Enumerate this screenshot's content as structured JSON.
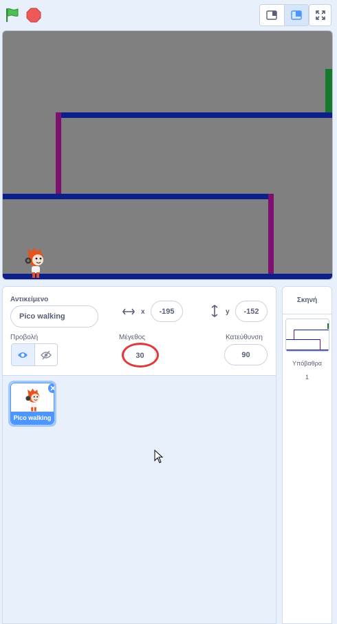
{
  "toolbar": {
    "green_flag_icon": "green-flag-icon",
    "stop_icon": "stop-sign-icon",
    "small_stage_icon": "small-stage-icon",
    "normal_stage_icon": "normal-stage-icon",
    "fullscreen_icon": "fullscreen-icon"
  },
  "stage": {
    "background_color": "#808080",
    "platform_blue": "#0c1f8a",
    "wall_purple": "#7d0f6e",
    "goal_green": "#157a2c",
    "sprite_color": "#e8521c"
  },
  "sprite_info": {
    "sprite_label": "Αντικείμενο",
    "sprite_name": "Pico walking",
    "x_label": "x",
    "x_value": "-195",
    "y_label": "y",
    "y_value": "-152",
    "show_label": "Προβολή",
    "size_label": "Μέγεθος",
    "size_value": "30",
    "direction_label": "Κατεύθυνση",
    "direction_value": "90"
  },
  "sprite_list": {
    "items": [
      {
        "name": "Pico walking",
        "selected": true
      }
    ]
  },
  "stage_panel": {
    "title": "Σκηνή",
    "backdrops_label": "Υπόβαθρα",
    "backdrops_count": "1"
  },
  "colors": {
    "accent": "#4c97ff",
    "highlight_ring": "#de3b3b",
    "flag_green": "#4cbf56",
    "stop_red": "#ec5959"
  }
}
